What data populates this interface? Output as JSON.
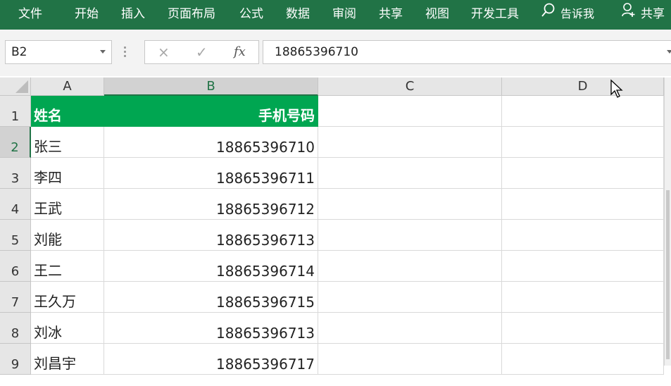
{
  "ribbon": {
    "tabs": [
      "文件",
      "开始",
      "插入",
      "页面布局",
      "公式",
      "数据",
      "审阅",
      "共享",
      "视图",
      "开发工具"
    ],
    "tell_me": "告诉我",
    "share": "共享"
  },
  "formula_bar": {
    "name_box": "B2",
    "fx_label": "fx",
    "cancel_icon": "×",
    "enter_icon": "✓",
    "formula_value": "18865396710"
  },
  "grid": {
    "columns": [
      "A",
      "B",
      "C",
      "D"
    ],
    "rows": [
      {
        "num": "1",
        "A": "姓名",
        "B": "手机号码"
      },
      {
        "num": "2",
        "A": "张三",
        "B": "18865396710"
      },
      {
        "num": "3",
        "A": "李四",
        "B": "18865396711"
      },
      {
        "num": "4",
        "A": "王武",
        "B": "18865396712"
      },
      {
        "num": "5",
        "A": "刘能",
        "B": "18865396713"
      },
      {
        "num": "6",
        "A": "王二",
        "B": "18865396714"
      },
      {
        "num": "7",
        "A": "王久万",
        "B": "18865396715"
      },
      {
        "num": "8",
        "A": "刘冰",
        "B": "18865396713"
      },
      {
        "num": "9",
        "A": "刘昌宇",
        "B": "18865396717"
      }
    ]
  },
  "colors": {
    "ribbon_bg": "#217346",
    "header_fill": "#00a651",
    "selection": "#217346"
  }
}
